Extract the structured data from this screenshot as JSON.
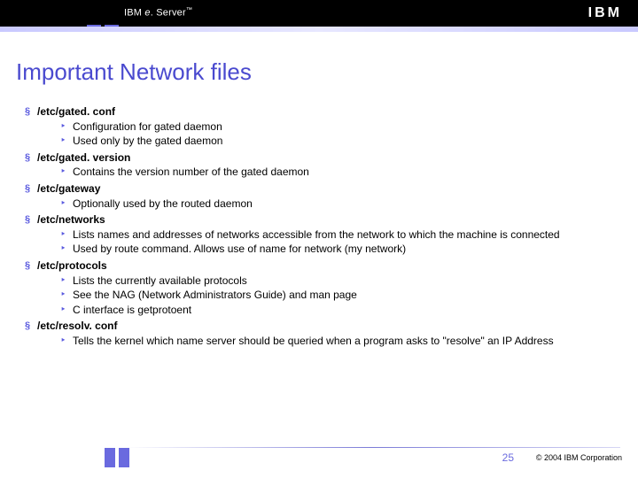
{
  "header": {
    "brand_prefix": "IBM ",
    "brand_e": "e",
    "brand_rest": ". Server",
    "tm": "™",
    "logo": "IBM"
  },
  "title": "Important Network files",
  "items": [
    {
      "label": "/etc/gated. conf",
      "sub": [
        "Configuration for gated daemon",
        "Used only by the gated daemon"
      ]
    },
    {
      "label": "/etc/gated. version",
      "sub": [
        "Contains the version number of the gated daemon"
      ]
    },
    {
      "label": " /etc/gateway",
      "sub": [
        "Optionally used by the routed daemon"
      ]
    },
    {
      "label": "/etc/networks",
      "sub": [
        "Lists names and addresses of networks accessible from the network to which the machine is connected",
        "Used by route command. Allows use of name for network (my network)"
      ]
    },
    {
      "label": "/etc/protocols",
      "sub": [
        "Lists the currently available protocols",
        "See the NAG (Network Administrators Guide) and man page",
        "C interface is getprotoent"
      ]
    },
    {
      "label": "/etc/resolv. conf",
      "sub": [
        "Tells the kernel which name server should be queried when a program asks to \"resolve\" an IP Address"
      ]
    }
  ],
  "footer": {
    "page": "25",
    "copyright": "© 2004 IBM Corporation"
  }
}
